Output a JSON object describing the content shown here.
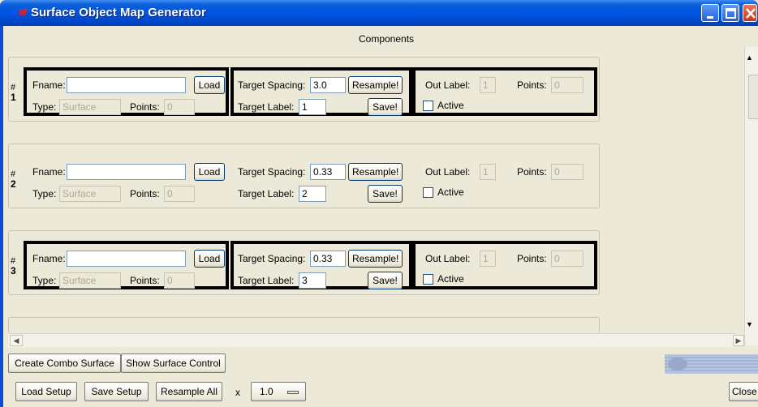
{
  "window": {
    "title": "Surface Object Map Generator"
  },
  "section_title": "Components",
  "labels": {
    "fname": "Fname:",
    "load": "Load",
    "type": "Type:",
    "points": "Points:",
    "target_spacing": "Target Spacing:",
    "resample": "Resample!",
    "target_label": "Target Label:",
    "save": "Save!",
    "out_label": "Out Label:",
    "active": "Active"
  },
  "components": [
    {
      "hash": "#",
      "number": "1",
      "fname": "",
      "type": "Surface",
      "points": "0",
      "target_spacing": "3.0",
      "target_label": "1",
      "out_label": "1",
      "out_points": "0",
      "active": false,
      "selected": true
    },
    {
      "hash": "#",
      "number": "2",
      "fname": "",
      "type": "Surface",
      "points": "0",
      "target_spacing": "0.33",
      "target_label": "2",
      "out_label": "1",
      "out_points": "0",
      "active": false,
      "selected": false
    },
    {
      "hash": "#",
      "number": "3",
      "fname": "",
      "type": "Surface",
      "points": "0",
      "target_spacing": "0.33",
      "target_label": "3",
      "out_label": "1",
      "out_points": "0",
      "active": false,
      "selected": true
    }
  ],
  "toolbar1": {
    "combo": "Create Combo Surface",
    "show_control": "Show Surface Control"
  },
  "toolbar2": {
    "load_setup": "Load Setup",
    "save_setup": "Save Setup",
    "resample_all": "Resample All",
    "x_label": "x",
    "scale_value": "1.0",
    "close": "Close"
  },
  "colors": {
    "titlebar": "#0054e3",
    "face": "#ece9d8",
    "selection_border": "#000000"
  }
}
